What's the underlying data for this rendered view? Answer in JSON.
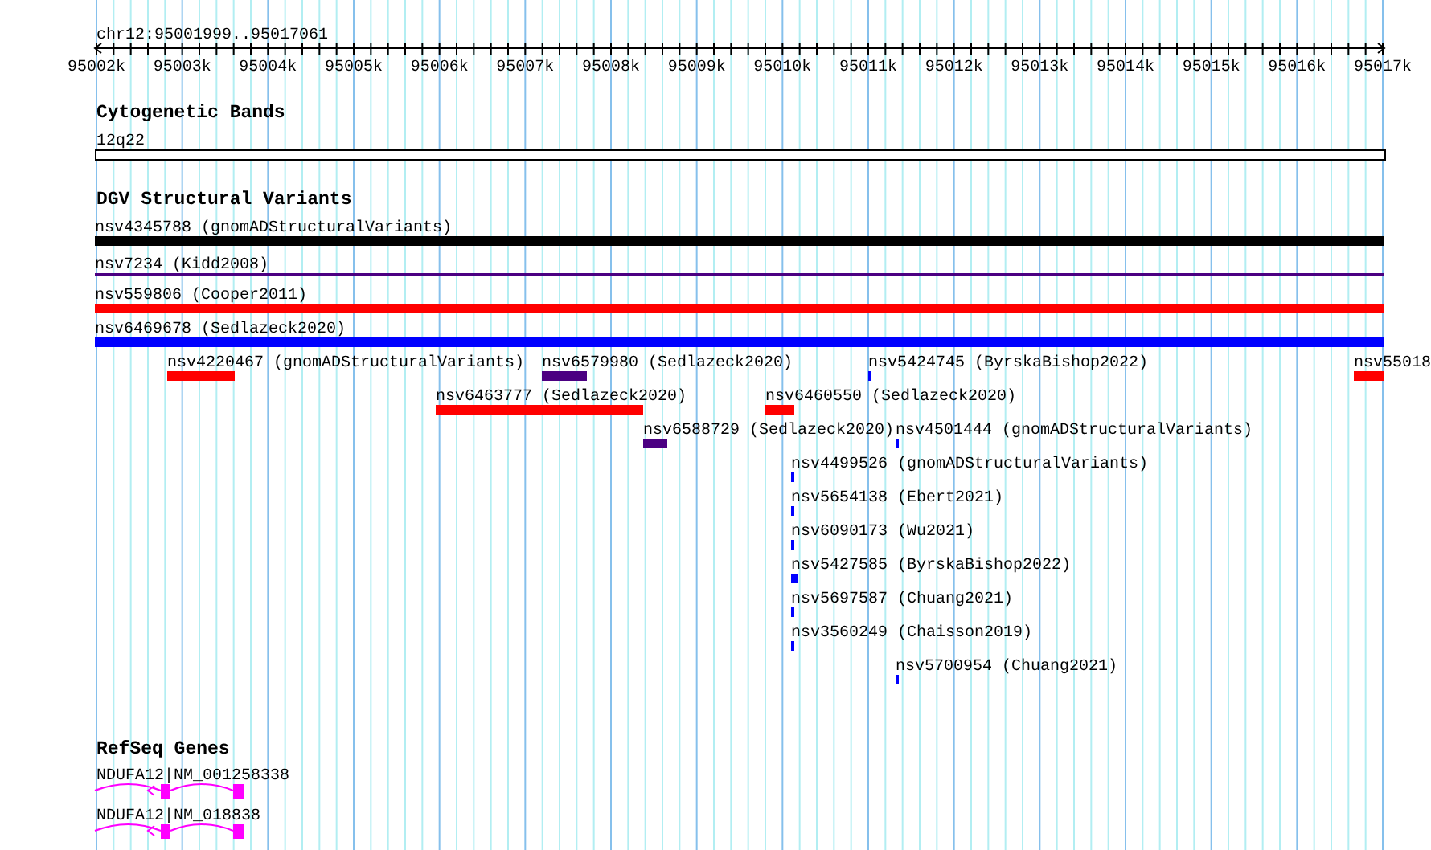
{
  "location": "chr12:95001999..95017061",
  "axis": {
    "ticks": [
      "95002k",
      "95003k",
      "95004k",
      "95005k",
      "95006k",
      "95007k",
      "95008k",
      "95009k",
      "95010k",
      "95011k",
      "95012k",
      "95013k",
      "95014k",
      "95015k",
      "95016k",
      "95017k"
    ]
  },
  "tracks": [
    {
      "title": "Cytogenetic Bands",
      "kind": "bands",
      "features": [
        {
          "label": "12q22"
        }
      ]
    },
    {
      "title": "DGV Structural Variants",
      "kind": "variants",
      "features": [
        {
          "label": "nsv4345788 (gnomADStructuralVariants)",
          "color": "#000000"
        },
        {
          "label": "nsv7234 (Kidd2008)",
          "color": "#4b0082"
        },
        {
          "label": "nsv559806 (Cooper2011)",
          "color": "#ff0000"
        },
        {
          "label": "nsv6469678 (Sedlazeck2020)",
          "color": "#0000ff"
        },
        {
          "label": "nsv4220467 (gnomADStructuralVariants)",
          "color": "#ff0000"
        },
        {
          "label": "nsv6579980 (Sedlazeck2020)",
          "color": "#4b0082"
        },
        {
          "label": "nsv5424745 (ByrskaBishop2022)",
          "color": "#0000ff"
        },
        {
          "label": "nsv55018",
          "color": "#ff0000"
        },
        {
          "label": "nsv6463777 (Sedlazeck2020)",
          "color": "#ff0000"
        },
        {
          "label": "nsv6460550 (Sedlazeck2020)",
          "color": "#ff0000"
        },
        {
          "label": "nsv6588729 (Sedlazeck2020)",
          "color": "#4b0082"
        },
        {
          "label": "nsv4501444 (gnomADStructuralVariants)",
          "color": "#0000ff"
        },
        {
          "label": "nsv4499526 (gnomADStructuralVariants)",
          "color": "#0000ff"
        },
        {
          "label": "nsv5654138 (Ebert2021)",
          "color": "#0000ff"
        },
        {
          "label": "nsv6090173 (Wu2021)",
          "color": "#0000ff"
        },
        {
          "label": "nsv5427585 (ByrskaBishop2022)",
          "color": "#0000ff"
        },
        {
          "label": "nsv5697587 (Chuang2021)",
          "color": "#0000ff"
        },
        {
          "label": "nsv3560249 (Chaisson2019)",
          "color": "#0000ff"
        },
        {
          "label": "nsv5700954 (Chuang2021)",
          "color": "#0000ff"
        }
      ]
    },
    {
      "title": "RefSeq Genes",
      "kind": "genes",
      "features": [
        {
          "label": "NDUFA12|NM_001258338"
        },
        {
          "label": "NDUFA12|NM_018838"
        }
      ]
    }
  ]
}
